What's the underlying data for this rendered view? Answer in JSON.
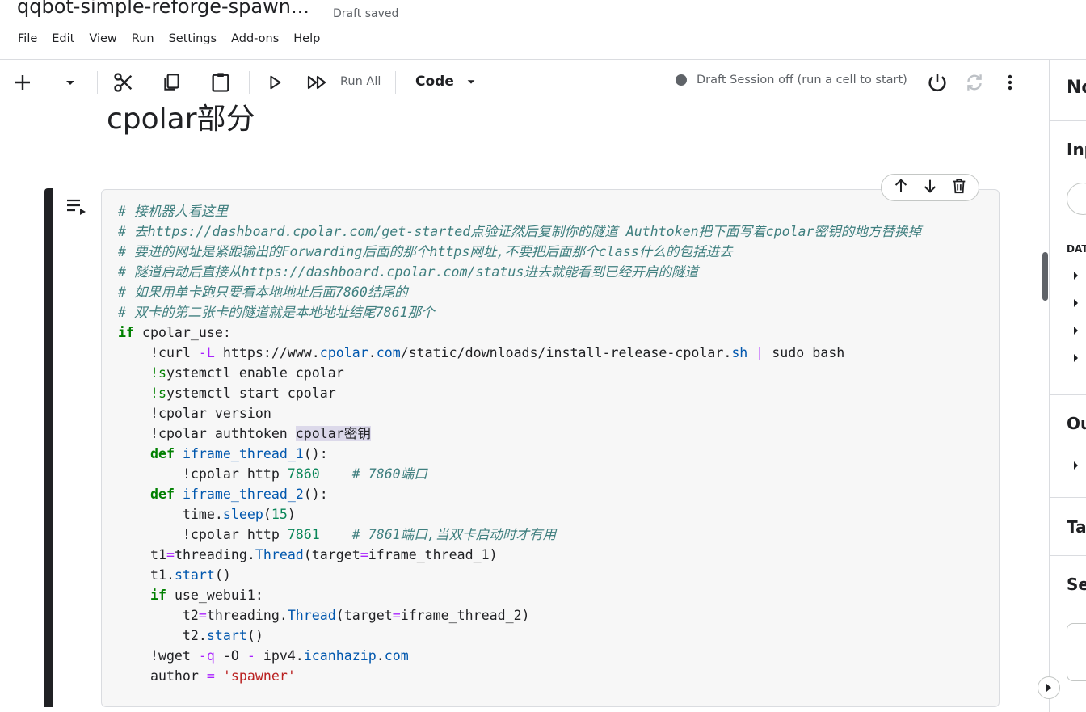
{
  "header": {
    "title": "qqbot-simple-reforge-spawn...",
    "status": "Draft saved"
  },
  "menu": [
    "File",
    "Edit",
    "View",
    "Run",
    "Settings",
    "Add-ons",
    "Help"
  ],
  "toolbar": {
    "run_all_label": "Run All",
    "cell_type": "Code",
    "session_status": "Draft Session off (run a cell to start)"
  },
  "notebook": {
    "heading": "cpolar部分"
  },
  "code_cell": {
    "comments": [
      "# 接机器人看这里",
      "# 去https://dashboard.cpolar.com/get-started点验证然后复制你的隧道 Authtoken把下面写着cpolar密钥的地方替换掉",
      "# 要进的网址是紧跟输出的Forwarding后面的那个https网址,不要把后面那个class什么的包括进去",
      "# 隧道启动后直接从https://dashboard.cpolar.com/status进去就能看到已经开启的隧道",
      "# 如果用单卡跑只要看本地地址后面7860结尾的",
      "# 双卡的第二张卡的隧道就是本地地址结尾7861那个"
    ],
    "lines": [
      "if cpolar_use:",
      "    !curl -L https://www.cpolar.com/static/downloads/install-release-cpolar.sh | sudo bash",
      "    !systemctl enable cpolar",
      "    !systemctl start cpolar",
      "    !cpolar version",
      "    !cpolar authtoken cpolar密钥",
      "    def iframe_thread_1():",
      "        !cpolar http 7860    # 7860端口",
      "    def iframe_thread_2():",
      "        time.sleep(15)",
      "        !cpolar http 7861    # 7861端口,当双卡启动时才有用",
      "    t1=threading.Thread(target=iframe_thread_1)",
      "    t1.start()",
      "    if use_webui1:",
      "        t2=threading.Thread(target=iframe_thread_2)",
      "        t2.start()",
      "    !wget -q -O - ipv4.icanhazip.com",
      "    author = 'spawner'"
    ]
  },
  "right_panel": {
    "title": "No",
    "input_heading": "Inp",
    "data_label": "DAT",
    "output_heading": "Ou",
    "table_heading": "Ta",
    "session_heading": "Se"
  },
  "icons": [
    "add-icon",
    "chevron-down-icon",
    "cut-icon",
    "copy-icon",
    "paste-icon",
    "run-icon",
    "run-all-icon",
    "power-icon",
    "refresh-icon",
    "more-vert-icon",
    "arrow-up-icon",
    "arrow-down-icon",
    "delete-icon",
    "cell-run-icon",
    "expand-icon"
  ]
}
